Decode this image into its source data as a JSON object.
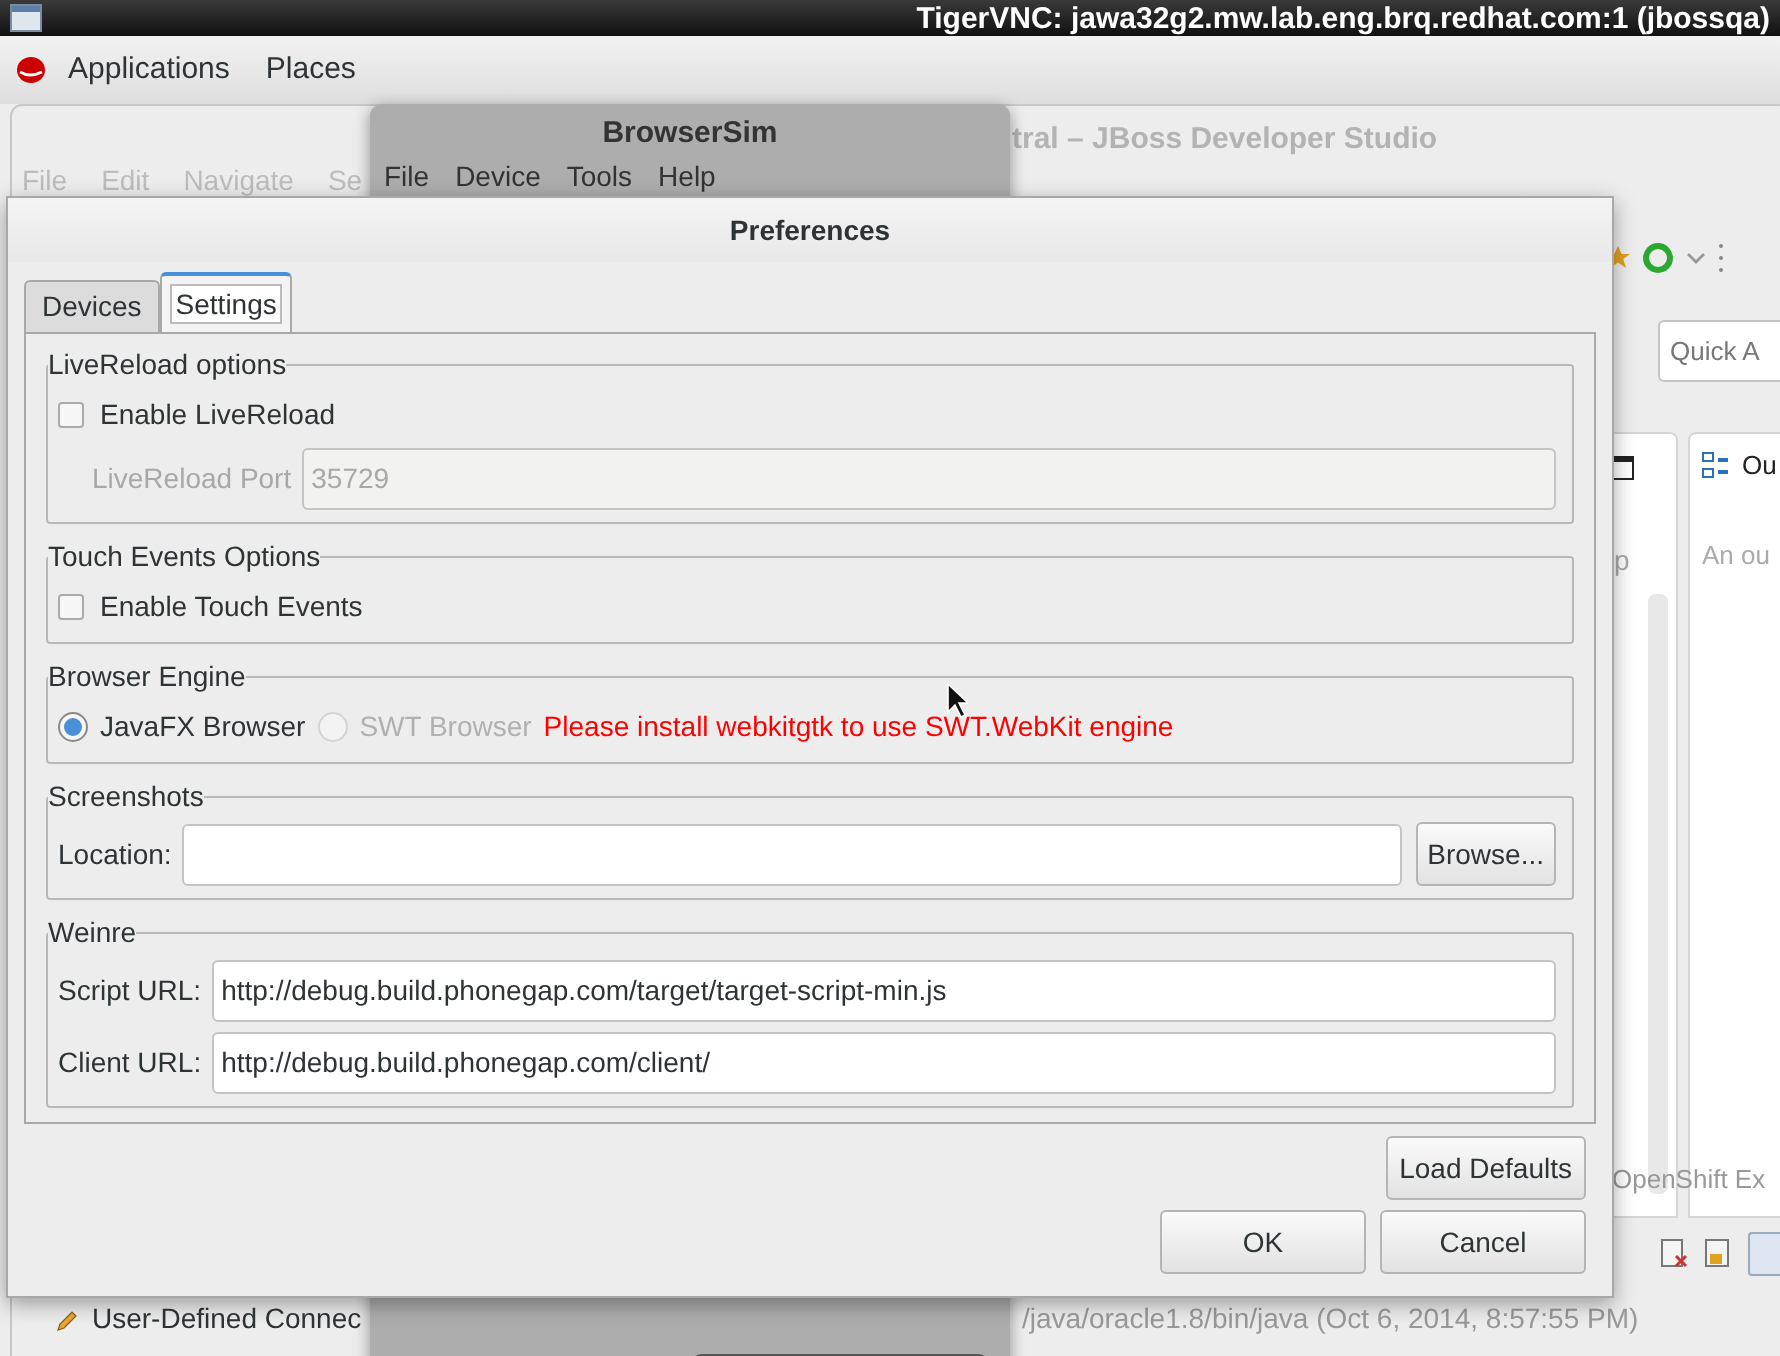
{
  "vnc": {
    "title": "TigerVNC: jawa32g2.mw.lab.eng.brq.redhat.com:1 (jbossqa)"
  },
  "panel": {
    "menus": [
      "Applications",
      "Places"
    ]
  },
  "ide": {
    "title": "tral – JBoss Developer Studio",
    "menu": [
      "File",
      "Edit",
      "Navigate",
      "Se"
    ],
    "quick_access": {
      "placeholder": "Quick A"
    },
    "outline": {
      "tab": "Ou",
      "message": "An ou"
    },
    "left_view_text": "p",
    "openshift_tab": "OpenShift Ex",
    "tree_item": "User-Defined Connec",
    "console_text": "/java/oracle1.8/bin/java (Oct 6, 2014, 8:57:55 PM)"
  },
  "browsersim": {
    "title": "BrowserSim",
    "menu": [
      "File",
      "Device",
      "Tools",
      "Help"
    ]
  },
  "dialog": {
    "title": "Preferences",
    "tabs": [
      {
        "label": "Devices",
        "selected": false
      },
      {
        "label": "Settings",
        "selected": true
      }
    ],
    "groups": [
      {
        "title": "LiveReload options",
        "rows": [
          [
            {
              "kind": "checkbox",
              "label": "Enable LiveReload",
              "checked": false
            }
          ],
          [
            {
              "kind": "field",
              "label": "LiveReload Port",
              "value": "35729",
              "disabled": true
            }
          ]
        ]
      },
      {
        "title": "Touch Events Options",
        "rows": [
          [
            {
              "kind": "checkbox",
              "label": "Enable Touch Events",
              "checked": false
            }
          ]
        ]
      },
      {
        "title": "Browser Engine",
        "rows": [
          [
            {
              "kind": "radio",
              "label": "JavaFX Browser",
              "selected": true,
              "disabled": false
            },
            {
              "kind": "radio",
              "label": "SWT Browser",
              "selected": false,
              "disabled": true
            },
            {
              "kind": "warning",
              "label": "Please install webkitgtk to use SWT.WebKit engine"
            }
          ]
        ]
      },
      {
        "title": "Screenshots",
        "rows": [
          [
            {
              "kind": "field",
              "label": "Location:",
              "disabled": false
            },
            {
              "kind": "button",
              "label": "Browse..."
            }
          ]
        ]
      },
      {
        "title": "Weinre",
        "rows": [
          [
            {
              "kind": "field",
              "label": "Script URL:",
              "value": "http://debug.build.phonegap.com/target/target-script-min.js",
              "disabled": false
            }
          ],
          [
            {
              "kind": "field",
              "label": "Client URL:",
              "value": "http://debug.build.phonegap.com/client/",
              "disabled": false
            }
          ]
        ]
      }
    ],
    "side_button": "Load Defaults",
    "buttons": [
      "OK",
      "Cancel"
    ]
  }
}
